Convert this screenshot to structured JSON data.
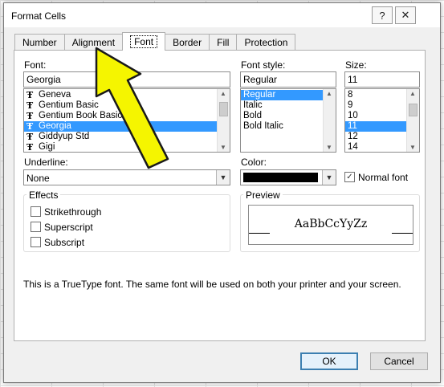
{
  "window": {
    "title": "Format Cells",
    "help": "?",
    "close": "✕"
  },
  "tabs": [
    "Number",
    "Alignment",
    "Font",
    "Border",
    "Fill",
    "Protection"
  ],
  "font": {
    "label": "Font:",
    "value": "Georgia",
    "items": [
      "Geneva",
      "Gentium Basic",
      "Gentium Book Basic",
      "Georgia",
      "Giddyup Std",
      "Gigi"
    ],
    "selected_index": 3,
    "truetype_glyph": "Ŧ"
  },
  "font_style": {
    "label": "Font style:",
    "value": "Regular",
    "items": [
      "Regular",
      "Italic",
      "Bold",
      "Bold Italic"
    ],
    "selected_index": 0
  },
  "size": {
    "label": "Size:",
    "value": "11",
    "items": [
      "8",
      "9",
      "10",
      "11",
      "12",
      "14"
    ],
    "selected_index": 3
  },
  "underline": {
    "label": "Underline:",
    "value": "None"
  },
  "color": {
    "label": "Color:",
    "swatch": "#000000"
  },
  "normal_font": {
    "label": "Normal font",
    "checked": true
  },
  "effects": {
    "title": "Effects",
    "options": [
      "Strikethrough",
      "Superscript",
      "Subscript"
    ]
  },
  "preview": {
    "title": "Preview",
    "sample": "AaBbCcYyZz"
  },
  "info_text": "This is a TrueType font.  The same font will be used on both your printer and your screen.",
  "buttons": {
    "ok": "OK",
    "cancel": "Cancel"
  },
  "annotation": {
    "arrow_color": "#f5f500",
    "target": "Alignment"
  }
}
